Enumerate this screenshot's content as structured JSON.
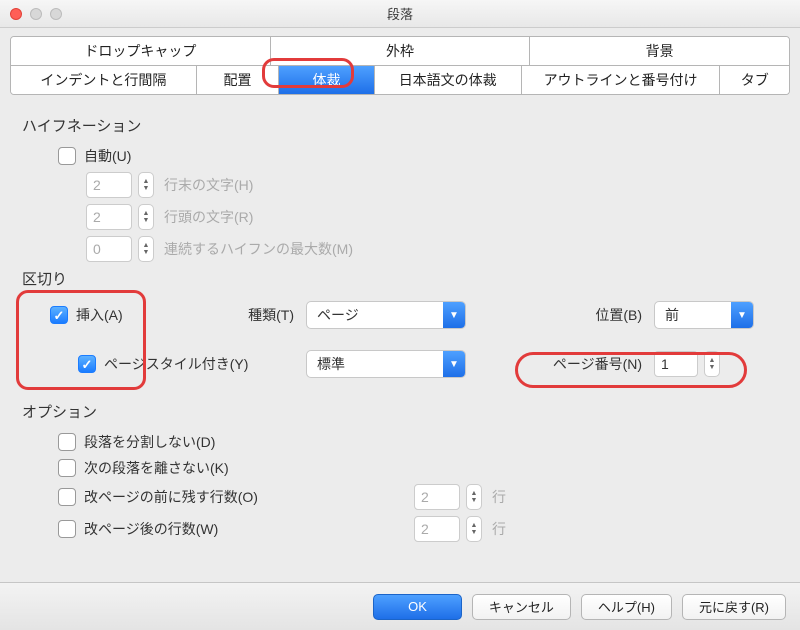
{
  "window": {
    "title": "段落"
  },
  "tabs": {
    "row1": [
      "ドロップキャップ",
      "外枠",
      "背景"
    ],
    "row2": [
      "インデントと行間隔",
      "配置",
      "体裁",
      "日本語文の体裁",
      "アウトラインと番号付け",
      "タブ"
    ],
    "active": "体裁"
  },
  "hyphenation": {
    "title": "ハイフネーション",
    "auto": {
      "label": "自動(U)",
      "checked": false
    },
    "lineEnd": {
      "value": "2",
      "label": "行末の文字(H)"
    },
    "lineStart": {
      "value": "2",
      "label": "行頭の文字(R)"
    },
    "maxCons": {
      "value": "0",
      "label": "連続するハイフンの最大数(M)"
    }
  },
  "breaks": {
    "title": "区切り",
    "insert": {
      "label": "挿入(A)",
      "checked": true
    },
    "type": {
      "label": "種類(T)",
      "value": "ページ"
    },
    "position": {
      "label": "位置(B)",
      "value": "前"
    },
    "withStyle": {
      "label": "ページスタイル付き(Y)",
      "checked": true
    },
    "styleValue": "標準",
    "pageNum": {
      "label": "ページ番号(N)",
      "value": "1"
    }
  },
  "options": {
    "title": "オプション",
    "noSplit": {
      "label": "段落を分割しない(D)",
      "checked": false
    },
    "keepNext": {
      "label": "次の段落を離さない(K)",
      "checked": false
    },
    "orphan": {
      "label": "改ページの前に残す行数(O)",
      "checked": false,
      "value": "2",
      "unit": "行"
    },
    "widow": {
      "label": "改ページ後の行数(W)",
      "checked": false,
      "value": "2",
      "unit": "行"
    }
  },
  "buttons": {
    "ok": "OK",
    "cancel": "キャンセル",
    "help": "ヘルプ(H)",
    "reset": "元に戻す(R)"
  }
}
